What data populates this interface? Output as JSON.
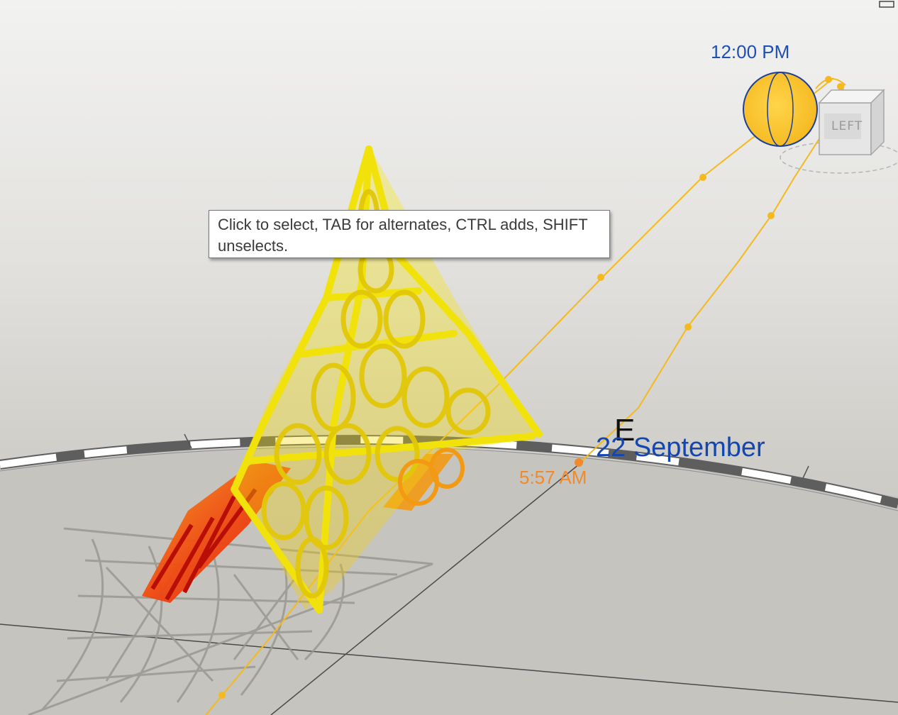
{
  "tooltip": {
    "text": "Click to select, TAB for alternates, CTRL adds, SHIFT unselects."
  },
  "sun_path": {
    "noon_time": "12:00 PM",
    "sunrise_time": "5:57 AM",
    "date": "22 September",
    "compass_east": "E"
  },
  "view_cube": {
    "face_label": "LEFT"
  },
  "colors": {
    "sun_fill": "#f9c62f",
    "sun_outline": "#1c3f9a",
    "path_line": "#f4b91f",
    "label_blue": "#1446b0",
    "label_orange": "#f08a2a",
    "structure_hot": "#e8180c",
    "structure_warm": "#f7e30c"
  },
  "icons": {
    "sun": "sun-icon",
    "view_cube": "view-cube-icon",
    "restore": "restore-window-icon"
  }
}
